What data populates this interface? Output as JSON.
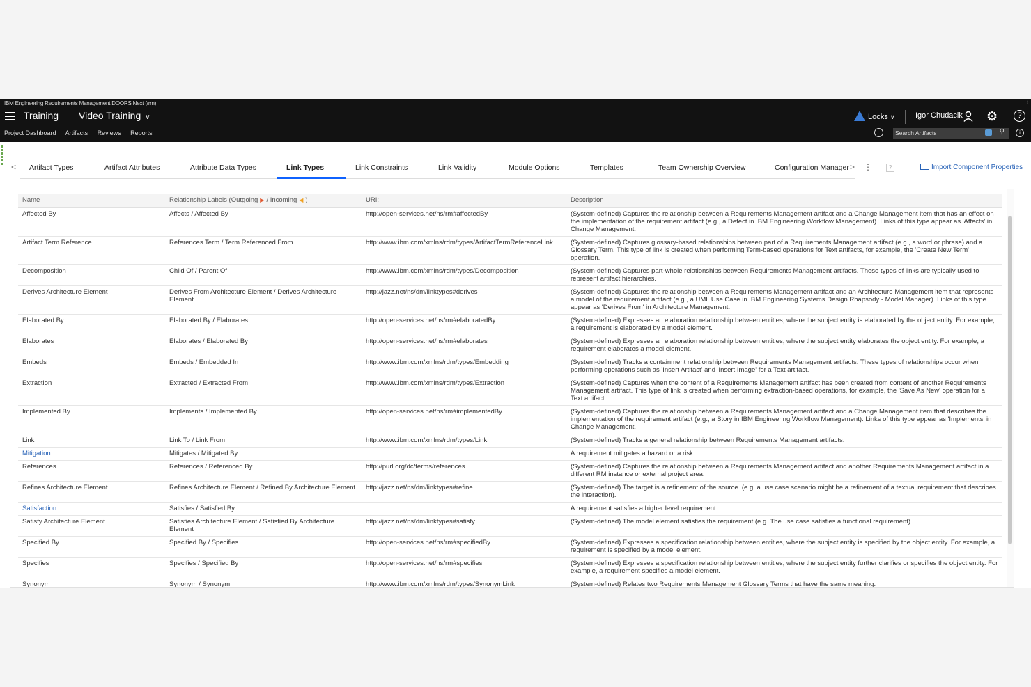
{
  "app": {
    "title": "IBM Engineering Requirements Management DOORS Next (/rm)",
    "project": "Training",
    "configuration": "Video Training",
    "locks_label": "Locks",
    "user_name": "Igor Chudacik",
    "nav": [
      "Project Dashboard",
      "Artifacts",
      "Reviews",
      "Reports"
    ],
    "search_placeholder": "Search Artifacts"
  },
  "tabs": {
    "items": [
      "Artifact Types",
      "Artifact Attributes",
      "Attribute Data Types",
      "Link Types",
      "Link Constraints",
      "Link Validity",
      "Module Options",
      "Templates",
      "Team Ownership Overview",
      "Configuration Manager"
    ],
    "active": "Link Types",
    "import_label": "Import Component Properties"
  },
  "table": {
    "headers": {
      "name": "Name",
      "labels_prefix": "Relationship Labels (Outgoing",
      "labels_mid": "/ Incoming",
      "labels_suffix": ")",
      "uri": "URI:",
      "description": "Description"
    },
    "rows": [
      {
        "name": "Affected By",
        "labels": "Affects / Affected By",
        "uri": "http://open-services.net/ns/rm#affectedBy",
        "description": "(System-defined) Captures the relationship between a Requirements Management artifact and a Change Management item that has an effect on the implementation of the requirement artifact (e.g., a Defect in IBM Engineering Workflow Management). Links of this type appear as 'Affects' in Change Management."
      },
      {
        "name": "Artifact Term Reference",
        "labels": "References Term / Term Referenced From",
        "uri": "http://www.ibm.com/xmlns/rdm/types/ArtifactTermReferenceLink",
        "description": "(System-defined) Captures glossary-based relationships between part of a Requirements Management artifact (e.g., a word or phrase) and a Glossary Term. This type of link is created when performing Term-based operations for Text artifacts, for example, the 'Create New Term' operation."
      },
      {
        "name": "Decomposition",
        "labels": "Child Of / Parent Of",
        "uri": "http://www.ibm.com/xmlns/rdm/types/Decomposition",
        "description": "(System-defined) Captures part-whole relationships between Requirements Management artifacts. These types of links are typically used to represent artifact hierarchies."
      },
      {
        "name": "Derives Architecture Element",
        "labels": "Derives From Architecture Element / Derives Architecture Element",
        "uri": "http://jazz.net/ns/dm/linktypes#derives",
        "description": "(System-defined) Captures the relationship between a Requirements Management artifact and an Architecture Management item that represents a model of the requirement artifact (e.g., a UML Use Case in IBM Engineering Systems Design Rhapsody - Model Manager). Links of this type appear as 'Derives From' in Architecture Management."
      },
      {
        "name": "Elaborated By",
        "labels": "Elaborated By / Elaborates",
        "uri": "http://open-services.net/ns/rm#elaboratedBy",
        "description": "(System-defined) Expresses an elaboration relationship between entities, where the subject entity is elaborated by the object entity. For example, a requirement is elaborated by a model element."
      },
      {
        "name": "Elaborates",
        "labels": "Elaborates / Elaborated By",
        "uri": "http://open-services.net/ns/rm#elaborates",
        "description": "(System-defined) Expresses an elaboration relationship between entities, where the subject entity elaborates the object entity. For example, a requirement elaborates a model element."
      },
      {
        "name": "Embeds",
        "labels": "Embeds / Embedded In",
        "uri": "http://www.ibm.com/xmlns/rdm/types/Embedding",
        "description": "(System-defined) Tracks a containment relationship between Requirements Management artifacts. These types of relationships occur when performing operations such as 'Insert Artifact' and 'Insert Image' for a Text artifact."
      },
      {
        "name": "Extraction",
        "labels": "Extracted / Extracted From",
        "uri": "http://www.ibm.com/xmlns/rdm/types/Extraction",
        "description": "(System-defined) Captures when the content of a Requirements Management artifact has been created from content of another Requirements Management artifact. This type of link is created when performing extraction-based operations, for example, the 'Save As New' operation for a Text artifact."
      },
      {
        "name": "Implemented By",
        "labels": "Implements / Implemented By",
        "uri": "http://open-services.net/ns/rm#implementedBy",
        "description": "(System-defined) Captures the relationship between a Requirements Management artifact and a Change Management item that describes the implementation of the requirement artifact (e.g., a Story in IBM Engineering Workflow Management). Links of this type appear as 'Implements' in Change Management."
      },
      {
        "name": "Link",
        "labels": "Link To / Link From",
        "uri": "http://www.ibm.com/xmlns/rdm/types/Link",
        "description": "(System-defined) Tracks a general relationship between Requirements Management artifacts."
      },
      {
        "name": "Mitigation",
        "labels": "Mitigates / Mitigated By",
        "uri": "",
        "description": "A requirement mitigates a hazard or a risk",
        "link": true
      },
      {
        "name": "References",
        "labels": "References / Referenced By",
        "uri": "http://purl.org/dc/terms/references",
        "description": "(System-defined) Captures the relationship between a Requirements Management artifact and another Requirements Management artifact in a different RM instance or external project area."
      },
      {
        "name": "Refines Architecture Element",
        "labels": "Refines Architecture Element / Refined By Architecture Element",
        "uri": "http://jazz.net/ns/dm/linktypes#refine",
        "description": "(System-defined) The target is a refinement of the source. (e.g. a use case scenario might be a refinement of a textual requirement that describes the interaction)."
      },
      {
        "name": "Satisfaction",
        "labels": "Satisfies / Satisfied By",
        "uri": "",
        "description": "A requirement satisfies a higher level requirement.",
        "link": true
      },
      {
        "name": "Satisfy Architecture Element",
        "labels": "Satisfies Architecture Element / Satisfied By Architecture Element",
        "uri": "http://jazz.net/ns/dm/linktypes#satisfy",
        "description": "(System-defined) The model element satisfies the requirement (e.g. The use case satisfies a functional requirement)."
      },
      {
        "name": "Specified By",
        "labels": "Specified By / Specifies",
        "uri": "http://open-services.net/ns/rm#specifiedBy",
        "description": "(System-defined) Expresses a specification relationship between entities, where the subject entity is specified by the object entity. For example, a requirement is specified by a model element."
      },
      {
        "name": "Specifies",
        "labels": "Specifies / Specified By",
        "uri": "http://open-services.net/ns/rm#specifies",
        "description": "(System-defined) Expresses a specification relationship between entities, where the subject entity further clarifies or specifies the object entity. For example, a requirement specifies a model element."
      },
      {
        "name": "Synonym",
        "labels": "Synonym / Synonym",
        "uri": "http://www.ibm.com/xmlns/rdm/types/SynonymLink",
        "description": "(System-defined) Relates two Requirements Management Glossary Terms that have the same meaning."
      }
    ]
  }
}
